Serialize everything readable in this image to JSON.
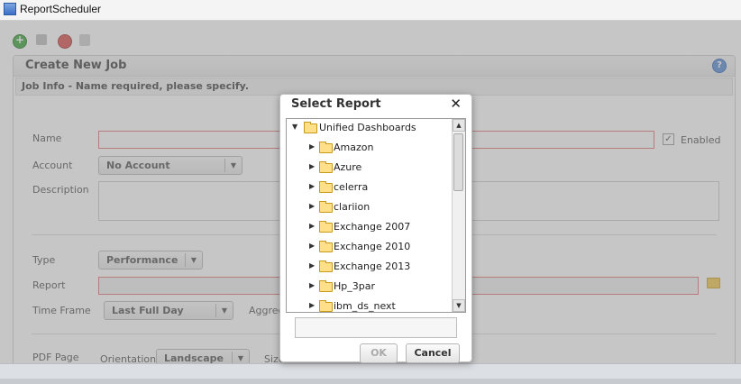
{
  "window": {
    "title": "ReportScheduler"
  },
  "panel": {
    "title": "Create New Job",
    "subheader": "Job Info - Name required, please specify."
  },
  "form": {
    "name_label": "Name",
    "enabled_label": "Enabled",
    "enabled_mark": "✓",
    "account_label": "Account",
    "account_value": "No Account",
    "description_label": "Description",
    "type_label": "Type",
    "type_value": "Performance",
    "report_label": "Report",
    "timeframe_label": "Time Frame",
    "timeframe_value": "Last Full Day",
    "aggregation_label": "Aggreg",
    "pdf_label": "PDF Page",
    "orientation_label": "Orientation",
    "orientation_value": "Landscape",
    "size_label": "Size"
  },
  "modal": {
    "title": "Select Report",
    "close": "✕",
    "root": "Unified Dashboards",
    "items": [
      "Amazon",
      "Azure",
      "celerra",
      "clariion",
      "Exchange 2007",
      "Exchange 2010",
      "Exchange 2013",
      "Hp_3par",
      "ibm_ds_next"
    ],
    "ok_label": "OK",
    "cancel_label": "Cancel",
    "input_value": ""
  },
  "glyphs": {
    "collapsed": "▶",
    "expanded": "▼",
    "scroll_up": "▲",
    "scroll_down": "▼",
    "select_arrow": "▼",
    "help": "?"
  }
}
